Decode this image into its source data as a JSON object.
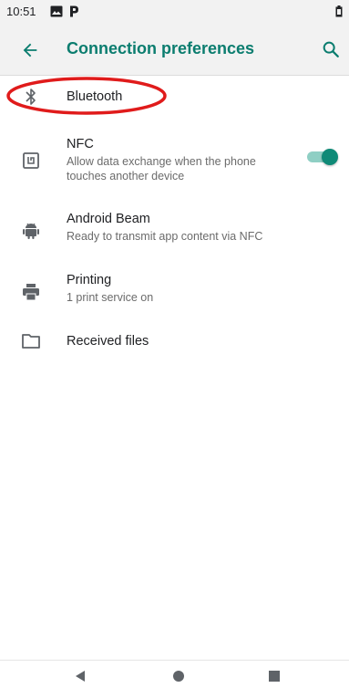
{
  "status_bar": {
    "time": "10:51",
    "icons": [
      "image-icon",
      "p-icon",
      "battery-icon"
    ]
  },
  "app_bar": {
    "title": "Connection preferences",
    "back_icon": "arrow-back-icon",
    "search_icon": "search-icon"
  },
  "items": [
    {
      "icon": "bluetooth-icon",
      "label": "Bluetooth"
    },
    {
      "icon": "nfc-icon",
      "label": "NFC",
      "subtitle": "Allow data exchange when the phone touches another device",
      "toggle_on": true
    },
    {
      "icon": "android-icon",
      "label": "Android Beam",
      "subtitle": "Ready to transmit app content via NFC"
    },
    {
      "icon": "printer-icon",
      "label": "Printing",
      "subtitle": "1 print service on"
    },
    {
      "icon": "folder-icon",
      "label": "Received files"
    }
  ],
  "colors": {
    "accent": "#0b7d6f",
    "toggle_thumb": "#0f8a77",
    "toggle_track": "#8fcfc4",
    "annotation": "#e01b1b",
    "bar_bg": "#f2f2f2"
  },
  "nav_bar": {
    "icons": [
      "back-triangle-icon",
      "home-circle-icon",
      "recents-square-icon"
    ]
  }
}
